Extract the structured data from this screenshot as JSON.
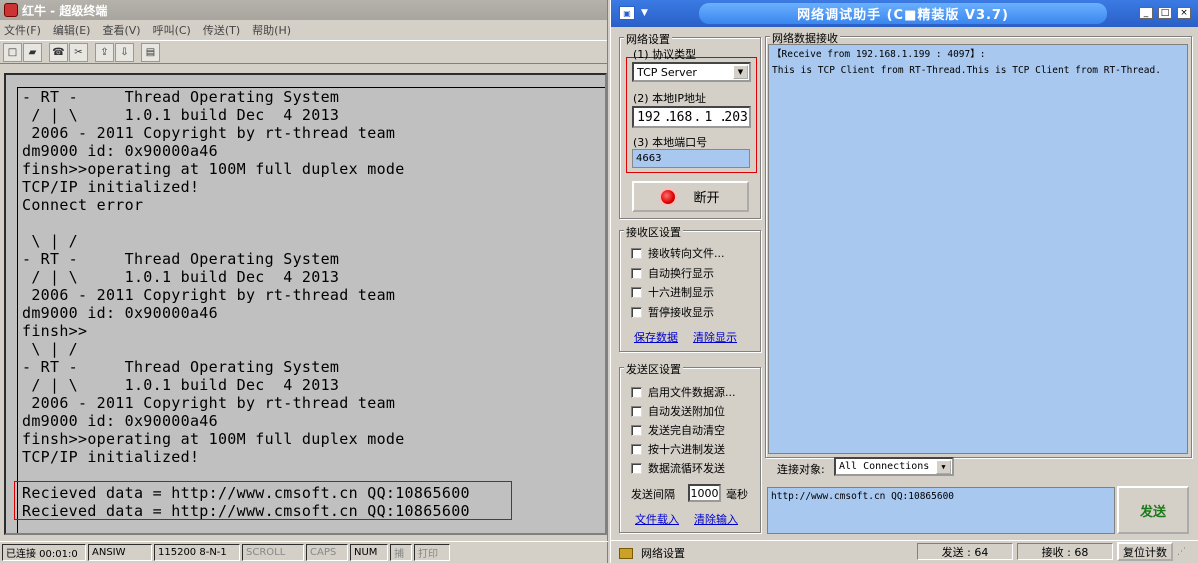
{
  "terminal": {
    "title": "红牛 - 超级终端",
    "menu": [
      "文件(F)",
      "编辑(E)",
      "查看(V)",
      "呼叫(C)",
      "传送(T)",
      "帮助(H)"
    ],
    "lines": [
      "- RT -     Thread Operating System",
      " / | \\     1.0.1 build Dec  4 2013",
      " 2006 - 2011 Copyright by rt-thread team",
      "dm9000 id: 0x90000a46",
      "finsh>>operating at 100M full duplex mode",
      "TCP/IP initialized!",
      "Connect error",
      "",
      " \\ | /",
      "- RT -     Thread Operating System",
      " / | \\     1.0.1 build Dec  4 2013",
      " 2006 - 2011 Copyright by rt-thread team",
      "dm9000 id: 0x90000a46",
      "finsh>>",
      " \\ | /",
      "- RT -     Thread Operating System",
      " / | \\     1.0.1 build Dec  4 2013",
      " 2006 - 2011 Copyright by rt-thread team",
      "dm9000 id: 0x90000a46",
      "finsh>>operating at 100M full duplex mode",
      "TCP/IP initialized!",
      "",
      "Recieved data = http://www.cmsoft.cn QQ:10865600",
      "Recieved data = http://www.cmsoft.cn QQ:10865600"
    ],
    "status": {
      "connected": "已连接 00:01:0",
      "emulation": "ANSIW",
      "port": "115200 8-N-1",
      "scroll": "SCROLL",
      "caps": "CAPS",
      "num": "NUM",
      "capture": "捕",
      "print": "打印"
    }
  },
  "net": {
    "title": "网络调试助手 (C■精装版 V3.7)",
    "net_settings": {
      "group": "网络设置",
      "protocol_label": "(1) 协议类型",
      "protocol_value": "TCP Server",
      "ip_label": "(2) 本地IP地址",
      "ip": [
        "192",
        "168",
        "1",
        "203"
      ],
      "port_label": "(3) 本地端口号",
      "port": "4663",
      "disconnect": "断开"
    },
    "recv_settings": {
      "group": "接收区设置",
      "options": [
        "接收转向文件...",
        "自动换行显示",
        "十六进制显示",
        "暂停接收显示"
      ],
      "save": "保存数据",
      "clear": "清除显示"
    },
    "send_settings": {
      "group": "发送区设置",
      "options": [
        "启用文件数据源...",
        "自动发送附加位",
        "发送完自动清空",
        "按十六进制发送",
        "数据流循环发送"
      ],
      "interval_label": "发送间隔",
      "interval_value": "1000",
      "interval_unit": "毫秒",
      "load_file": "文件载入",
      "clear_input": "清除输入"
    },
    "recv": {
      "group": "网络数据接收",
      "header": "【Receive from 192.168.1.199 : 4097】:",
      "content": "This is TCP Client from RT-Thread.This is TCP Client from RT-Thread."
    },
    "target": {
      "label": "连接对象:",
      "value": "All Connections"
    },
    "send": {
      "text": "http://www.cmsoft.cn QQ:10865600",
      "button": "发送"
    },
    "status": {
      "state": "网络设置",
      "sent": "发送 : 64",
      "received": "接收 : 68",
      "reset": "复位计数"
    }
  }
}
